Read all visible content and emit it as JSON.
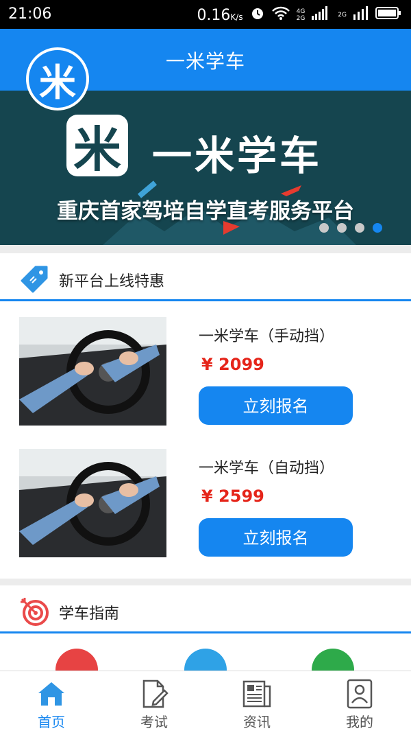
{
  "status_bar": {
    "time": "21:06",
    "speed": "0.16",
    "speed_unit": "K/s",
    "network_4g": "4G",
    "network_2g": "2G",
    "network_2g_b": "2G"
  },
  "header": {
    "title": "一米学车",
    "logo_glyph": "米"
  },
  "banner": {
    "logo_glyph": "米",
    "brand": "一米学车",
    "slogan": "重庆首家驾培自学直考服务平台",
    "slide_count": 4,
    "active_slide": 4
  },
  "promo": {
    "title": "新平台上线特惠",
    "courses": [
      {
        "name": "一米学车（手动挡）",
        "price": "¥ 2099",
        "button": "立刻报名"
      },
      {
        "name": "一米学车（自动挡）",
        "price": "¥ 2599",
        "button": "立刻报名"
      }
    ]
  },
  "guide": {
    "title": "学车指南"
  },
  "tabbar": {
    "items": [
      {
        "label": "首页",
        "icon": "home-icon"
      },
      {
        "label": "考试",
        "icon": "document-edit-icon"
      },
      {
        "label": "资讯",
        "icon": "newspaper-icon"
      },
      {
        "label": "我的",
        "icon": "profile-icon"
      }
    ],
    "active": 0
  },
  "colors": {
    "primary": "#1586f0",
    "price": "#e5251a",
    "banner_bg": "#15454f"
  }
}
